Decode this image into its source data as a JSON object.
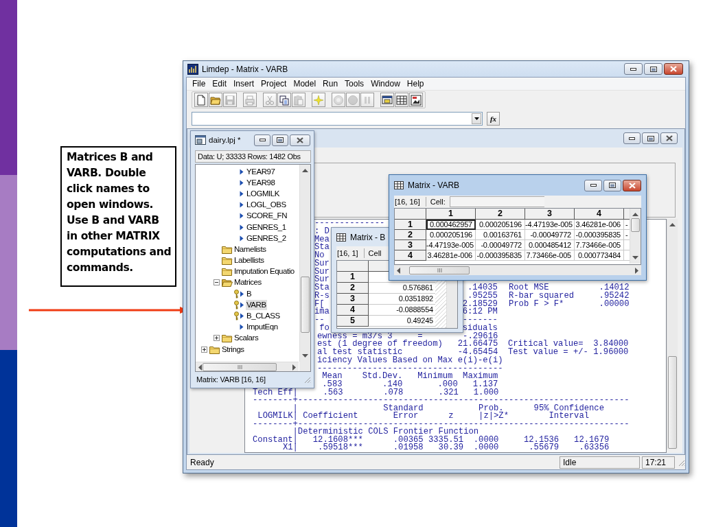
{
  "slide": {
    "callout": "Matrices B and VARB. Double click names to open windows. Use B and VARB in other MATRIX computations and commands."
  },
  "window": {
    "title": "Limdep - Matrix - VARB",
    "active": true
  },
  "menu": [
    "File",
    "Edit",
    "Insert",
    "Project",
    "Model",
    "Run",
    "Tools",
    "Window",
    "Help"
  ],
  "toolbar": [
    [
      {
        "disabled": false
      },
      {
        "disabled": false
      },
      {
        "disabled": true
      }
    ],
    [
      {
        "disabled": true
      }
    ],
    [
      {
        "disabled": true
      },
      {
        "disabled": false
      },
      {
        "disabled": true
      }
    ],
    [
      {
        "disabled": false
      }
    ],
    [
      {
        "disabled": true
      },
      {
        "disabled": true
      },
      {
        "disabled": true
      }
    ],
    [
      {
        "disabled": false
      },
      {
        "disabled": false
      },
      {
        "disabled": false
      }
    ]
  ],
  "formula_bar": {
    "fx_label": "fx"
  },
  "output_window": {
    "active": false,
    "covered_lines": [
      {
        "left": "--------------"
      },
      {
        "left": ": D"
      },
      {
        "left": "Mea"
      },
      {
        "left": "Sta"
      },
      {
        "left": "No"
      },
      {
        "left": "Sur"
      },
      {
        "left": "Sur"
      },
      {
        "left": "Sur"
      },
      {
        "left": "Sta",
        "value": ".14035",
        "note": "Root MSE          .14012"
      },
      {
        "left": "R-s",
        "value": ".95255",
        "note": "R-bar squared     .95242"
      },
      {
        "left": "F[",
        "value": "2.18529",
        "note": "Prob F > F*       .00000"
      },
      {
        "left": "ima",
        "value": "6:12 PM"
      },
      {
        "left": "--",
        "value": "-------"
      },
      {
        "left": " fo",
        "value": "siduals"
      }
    ],
    "upper_lines": [
      "ewness = m3/s 3     =        -.29616",
      "est (1 degree of freedom)   21.66475  Critical value=  3.84000",
      "al test statistic           -4.65454  Test value = +/- 1.96000",
      "iciency Values Based on Max e(i)-e(i)",
      "-------------------------------------",
      " Mean    Std.Dev.   Minimum  Maximum",
      " .583        .140       .000   1.137"
    ],
    "lower_lines": [
      "Tech Eff|     .563        .078       .321   1.000",
      "--------+------------------------------------------------------------------",
      "        |                 Standard           Prob.      95% Confidence",
      " LOGMILK| Coefficient       Error      z     |z|>Z*        Interval",
      "--------+------------------------------------------------------------------",
      "        |Deterministic COLS Frontier Function",
      "Constant|   12.1608***      .00365 3335.51  .0000     12.1536   12.1679",
      "      X1|    .59518***      .01958   30.39  .0000      .55679    .63356"
    ]
  },
  "project_window": {
    "title": "dairy.lpj *",
    "active": false,
    "info": "Data: U; 33333 Rows: 1482 Obs",
    "tree": [
      {
        "children": [
          {
            "children": [
              {
                "label": "YEAR97",
                "kind": "variable",
                "selected": false
              },
              {
                "label": "YEAR98",
                "kind": "variable",
                "selected": false
              },
              {
                "label": "LOGMILK",
                "kind": "variable",
                "selected": false
              },
              {
                "label": "LOGL_OBS",
                "kind": "variable",
                "selected": false
              },
              {
                "label": "SCORE_FN",
                "kind": "variable",
                "selected": false
              },
              {
                "label": "GENRES_1",
                "kind": "variable",
                "selected": false
              },
              {
                "label": "GENRES_2",
                "kind": "variable",
                "selected": false
              }
            ]
          },
          {
            "label": "Namelists",
            "kind": "folder",
            "selected": false
          },
          {
            "label": "Labellists",
            "kind": "folder",
            "selected": false
          },
          {
            "label": "Imputation Equatio",
            "kind": "folder",
            "selected": false
          },
          {
            "label": "Matrices",
            "kind": "folder",
            "selected": false,
            "expanded": true,
            "children": [
              {
                "label": "B",
                "kind": "matrix",
                "selected": false
              },
              {
                "label": "VARB",
                "kind": "matrix",
                "selected": true
              },
              {
                "label": "B_CLASS",
                "kind": "matrix",
                "selected": false
              },
              {
                "label": "ImputEqn",
                "kind": "variable",
                "selected": false
              }
            ]
          },
          {
            "label": "Scalars",
            "kind": "folder",
            "selected": false,
            "expanded": false
          }
        ]
      },
      {
        "label": "Strings",
        "kind": "folder",
        "selected": false,
        "expanded": false
      }
    ],
    "status": "Matrix: VARB [16, 16]"
  },
  "matrix_windows": [
    {
      "title": "Matrix - B",
      "size": "[16, 1]",
      "cell_label": "Cell",
      "rows": [
        {
          "label": "1",
          "cells": []
        },
        {
          "label": "2",
          "cells": [
            {
              "text": "0.576861",
              "selected": false
            }
          ]
        },
        {
          "label": "3",
          "cells": [
            {
              "text": "0.0351892",
              "selected": false
            }
          ]
        },
        {
          "label": "4",
          "cells": [
            {
              "text": "-0.0888554",
              "selected": false
            }
          ]
        },
        {
          "label": "5",
          "cells": [
            {
              "text": "0.49245",
              "selected": false
            }
          ]
        }
      ]
    },
    {
      "title": "Matrix - VARB",
      "active": true,
      "size": "[16, 16]",
      "cell_label": "Cell:",
      "columns": [
        "1",
        "2",
        "3",
        "4"
      ],
      "rows": [
        {
          "label": "1",
          "cells": [
            {
              "text": "0.000462957",
              "selected": true
            },
            {
              "text": "0.000205196",
              "selected": false
            },
            {
              "text": "-4.47193e-005",
              "selected": false
            },
            {
              "text": "3.46281e-006",
              "selected": false
            },
            {
              "text": "-",
              "selected": false
            }
          ]
        },
        {
          "label": "2",
          "cells": [
            {
              "text": "0.000205196",
              "selected": false
            },
            {
              "text": "0.00163761",
              "selected": false
            },
            {
              "text": "-0.00049772",
              "selected": false
            },
            {
              "text": "-0.000395835",
              "selected": false
            },
            {
              "text": "-",
              "selected": false
            }
          ]
        },
        {
          "label": "3",
          "cells": [
            {
              "text": "-4.47193e-005",
              "selected": false
            },
            {
              "text": "-0.00049772",
              "selected": false
            },
            {
              "text": "0.000485412",
              "selected": false
            },
            {
              "text": "7.73466e-005",
              "selected": false
            },
            {
              "selected": false
            }
          ]
        },
        {
          "label": "4",
          "cells": [
            {
              "text": "3.46281e-006",
              "selected": false
            },
            {
              "text": "-0.000395835",
              "selected": false
            },
            {
              "text": "7.73466e-005",
              "selected": false
            },
            {
              "text": "0.000773484",
              "selected": false
            },
            {
              "selected": false
            }
          ]
        }
      ]
    }
  ],
  "status_bar": [
    "Ready",
    "Idle",
    "17:21"
  ]
}
